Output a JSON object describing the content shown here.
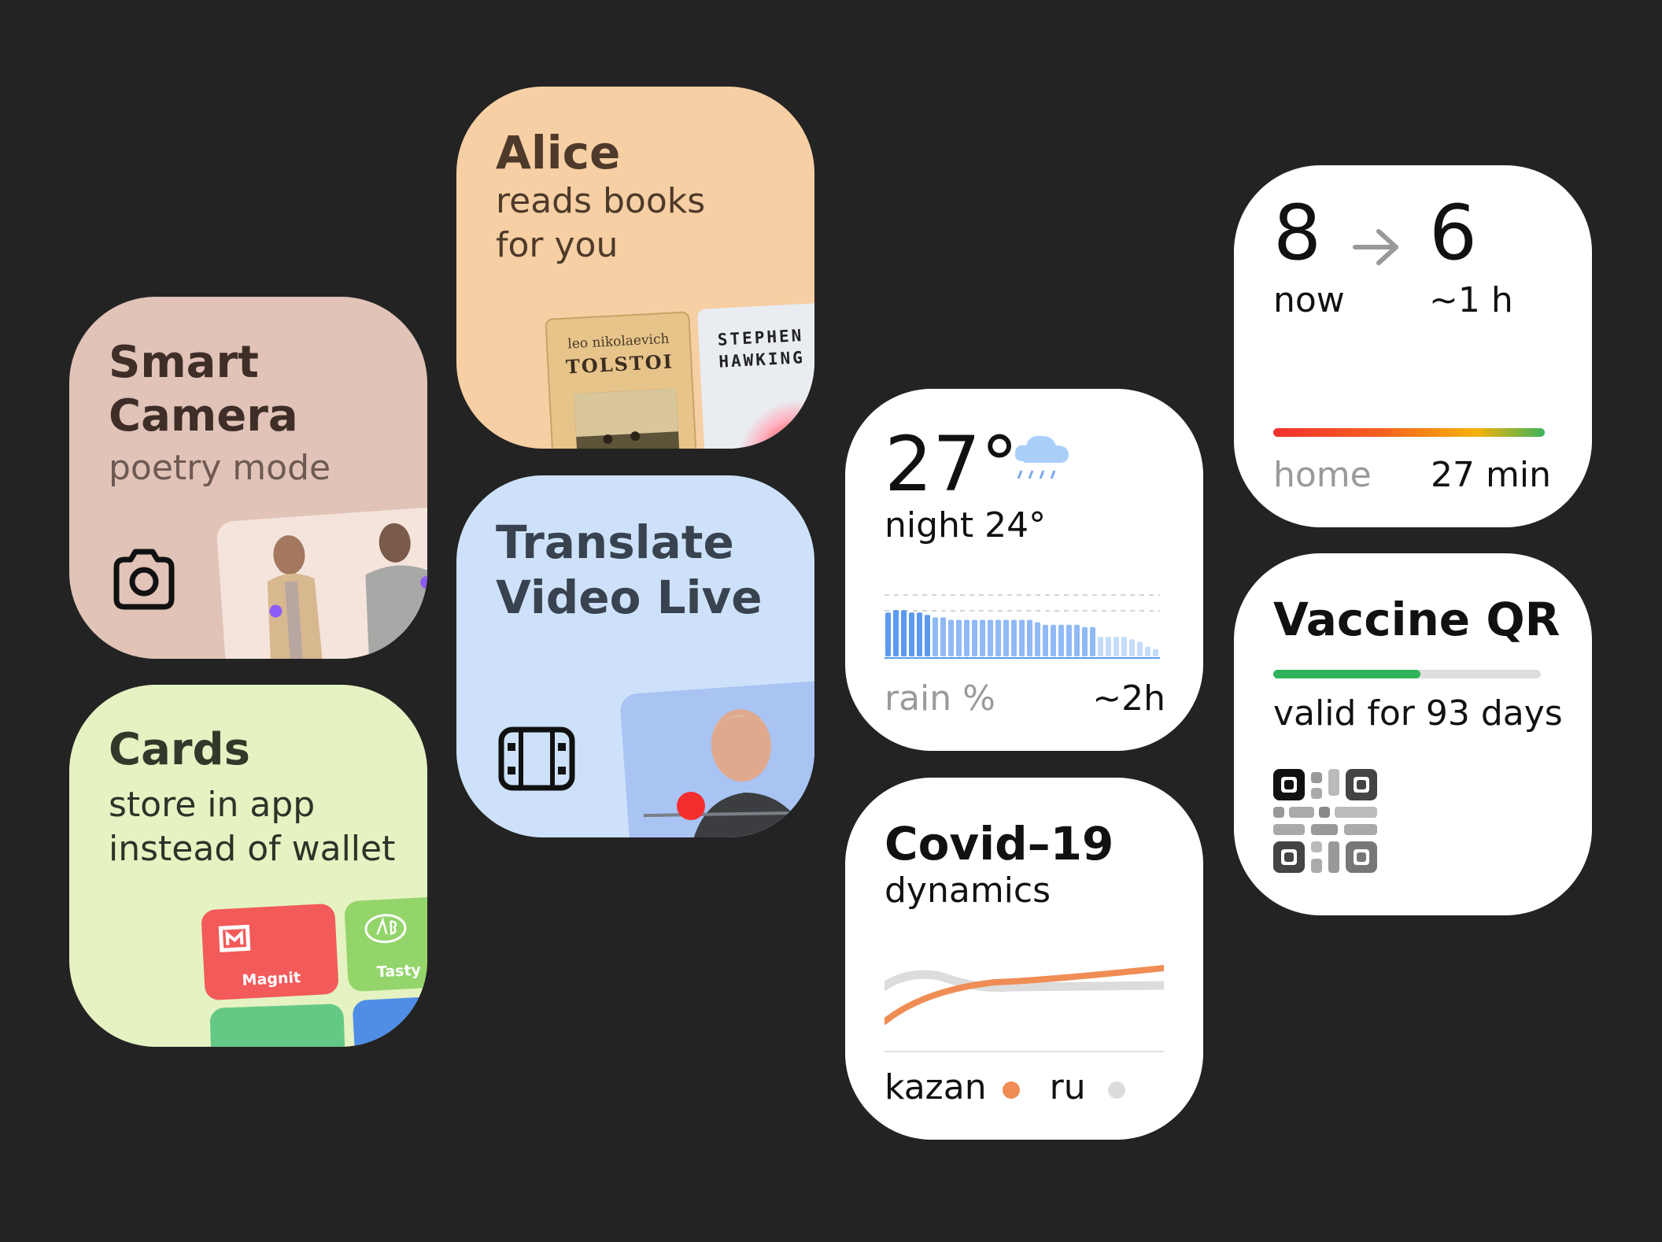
{
  "smart_camera": {
    "title_line1": "Smart",
    "title_line2": "Camera",
    "subtitle": "poetry mode",
    "icon": "camera-icon"
  },
  "cards": {
    "title": "Cards",
    "subtitle_line1": "store in app",
    "subtitle_line2": "instead of wallet",
    "loyalty_cards": [
      "Magnit",
      "Tasty"
    ]
  },
  "alice": {
    "title": "Alice",
    "subtitle_line1": "reads books",
    "subtitle_line2": "for you",
    "books": [
      {
        "author": "leo nikolaevich",
        "name": "TOLSTOI"
      },
      {
        "author": "STEPHEN",
        "name": "HAWKING"
      }
    ]
  },
  "translate": {
    "title_line1": "Translate",
    "title_line2": "Video Live",
    "icon": "film-icon"
  },
  "weather": {
    "temperature": "27°",
    "night": "night 24°",
    "rain_label": "rain %",
    "rain_time": "~2h",
    "rain_levels": [
      0.9,
      0.95,
      0.95,
      0.9,
      0.9,
      0.85,
      0.8,
      0.8,
      0.75,
      0.75,
      0.75,
      0.75,
      0.75,
      0.75,
      0.75,
      0.75,
      0.75,
      0.75,
      0.75,
      0.7,
      0.65,
      0.65,
      0.65,
      0.65,
      0.65,
      0.6,
      0.6,
      0.4,
      0.4,
      0.4,
      0.4,
      0.35,
      0.3,
      0.2,
      0.15
    ]
  },
  "covid": {
    "title": "Covid–19",
    "subtitle": "dynamics",
    "legend": [
      "kazan",
      "ru"
    ],
    "colors": {
      "kazan": "#ef8d55",
      "ru": "#dcdcdc"
    }
  },
  "traffic": {
    "now_value": "8",
    "later_value": "6",
    "now_label": "now",
    "later_label": "~1 h",
    "destination": "home",
    "duration": "27 min"
  },
  "vaccine": {
    "title": "Vaccine QR",
    "validity": "valid for 93 days",
    "progress": 0.55
  }
}
